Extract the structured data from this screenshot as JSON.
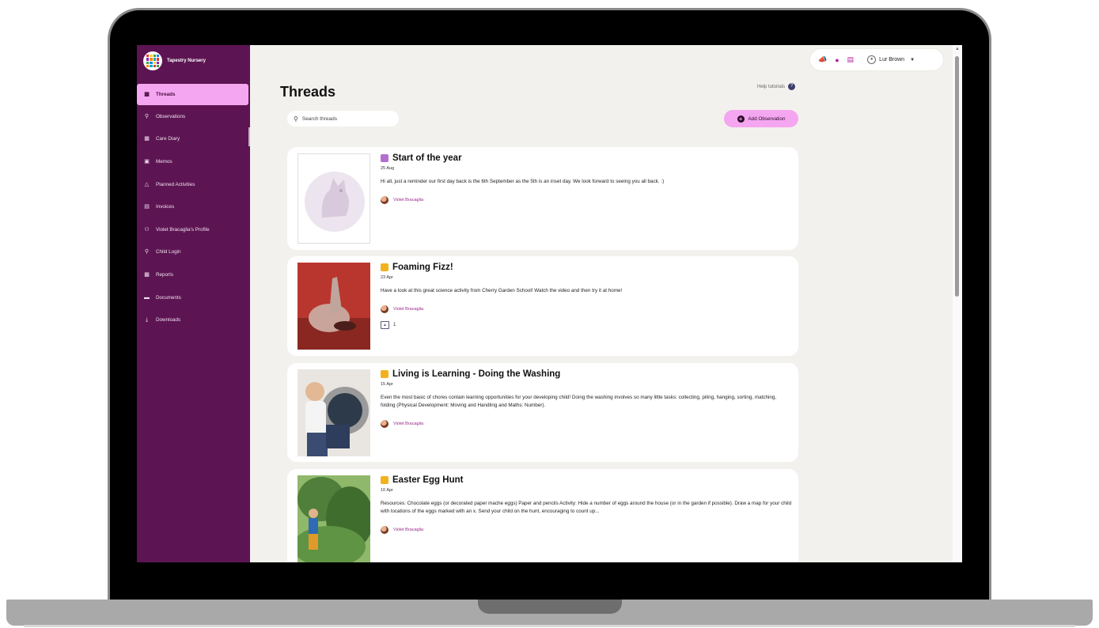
{
  "sidebar": {
    "brand": "Tapestry Nursery",
    "items": [
      {
        "label": "Threads",
        "icon": "threads-icon",
        "active": true
      },
      {
        "label": "Observations",
        "icon": "observations-icon"
      },
      {
        "label": "Care Diary",
        "icon": "care-diary-icon"
      },
      {
        "label": "Memos",
        "icon": "memos-icon"
      },
      {
        "label": "Planned Activities",
        "icon": "planned-activities-icon"
      },
      {
        "label": "Invoices",
        "icon": "invoices-icon"
      },
      {
        "label": "Violet Bracaglia's Profile",
        "icon": "profile-icon"
      },
      {
        "label": "Child Login",
        "icon": "key-icon"
      },
      {
        "label": "Reports",
        "icon": "reports-icon"
      },
      {
        "label": "Documents",
        "icon": "folder-icon"
      },
      {
        "label": "Downloads",
        "icon": "download-icon"
      }
    ]
  },
  "topbar": {
    "user_name": "Lur Brown",
    "icons": [
      "megaphone-icon",
      "bell-icon",
      "message-icon",
      "user-icon"
    ]
  },
  "main": {
    "title": "Threads",
    "help_label": "Help tutorials",
    "search_placeholder": "Search threads",
    "add_button_label": "Add Observation"
  },
  "threads": [
    {
      "title": "Start of the year",
      "date": "25 Aug",
      "text": "Hi all, just a reminder our first day back is the 6th September as the 5th is an inset day. We look forward to seeing you all back. :)",
      "author": "Violet Bracaglia",
      "tag_color": "#b26fd0"
    },
    {
      "title": "Foaming Fizz!",
      "date": "23 Apr",
      "text": "Have a look at this great science activity from Cherry Garden School! Watch the video and then try it at home!",
      "author": "Violet Bracaglia",
      "attachments": "1",
      "tag_color": "#f2b21d"
    },
    {
      "title": "Living is Learning - Doing the Washing",
      "date": "15 Apr",
      "text": "Even the most basic of chores contain learning opportunities for your developing child! Doing the washing involves so many little tasks: collecting, piling, hanging, sorting, matching, folding (Physical Development: Moving and Handling and Maths: Number).",
      "author": "Violet Bracaglia",
      "tag_color": "#f2b21d"
    },
    {
      "title": "Easter Egg Hunt",
      "date": "10 Apr",
      "text": "Resources: Chocolate eggs (or decorated paper mache eggs) Paper and pencils Activity: Hide a number of eggs around the house (or in the garden if possible). Draw a map for your child with locations of the eggs marked with an x. Send your child on the hunt, encouraging to count up...",
      "author": "Violet Bracaglia",
      "tag_color": "#f2b21d"
    }
  ]
}
